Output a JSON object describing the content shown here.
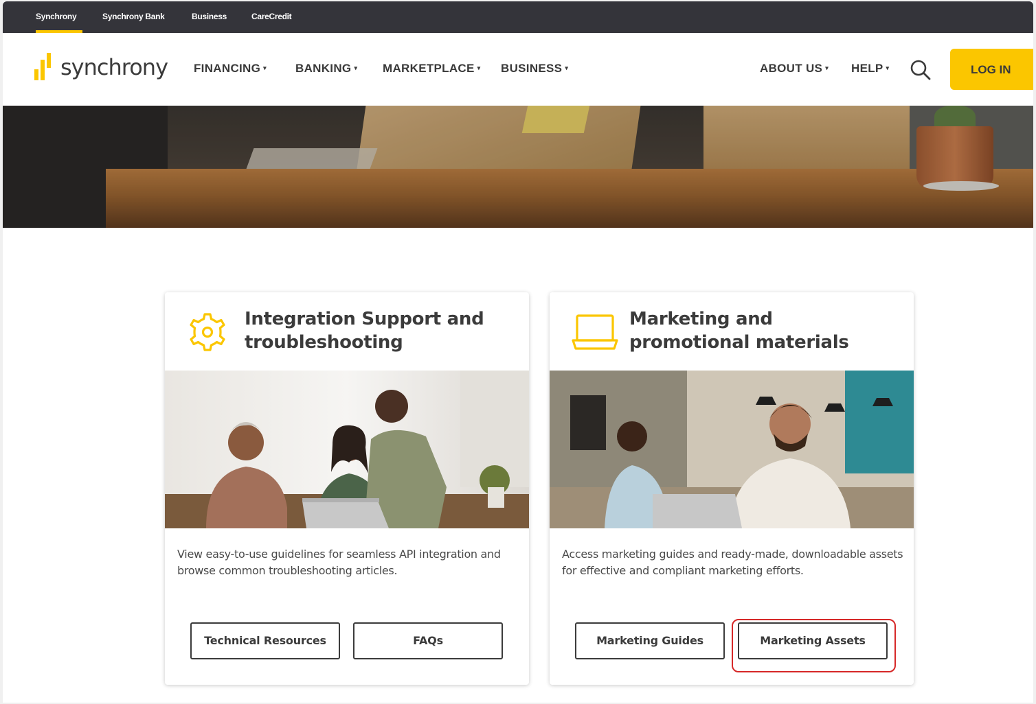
{
  "utility_nav": {
    "items": [
      "Synchrony",
      "Synchrony Bank",
      "Business",
      "CareCredit"
    ],
    "active": "Synchrony"
  },
  "brand": {
    "logo_text": "synchrony",
    "accent": "#fbc600",
    "dark": "#34343a"
  },
  "main_nav": {
    "financing": "FINANCING",
    "banking": "BANKING",
    "marketplace": "MARKETPLACE",
    "business": "BUSINESS",
    "about": "ABOUT US",
    "help": "HELP",
    "login": "LOG IN"
  },
  "cards": [
    {
      "icon": "gear-icon",
      "title": "Integration Support and troubleshooting",
      "description": "View easy-to-use guidelines for seamless API integration and browse common troubleshooting articles.",
      "buttons": [
        "Technical Resources",
        "FAQs"
      ]
    },
    {
      "icon": "laptop-icon",
      "title": "Marketing and promotional materials",
      "description": "Access marketing guides and ready-made, downloadable assets for effective and compliant marketing efforts.",
      "buttons": [
        "Marketing Guides",
        "Marketing Assets"
      ]
    }
  ],
  "annotation": {
    "highlight_color": "#d62828",
    "highlighted": "Marketing Assets"
  }
}
